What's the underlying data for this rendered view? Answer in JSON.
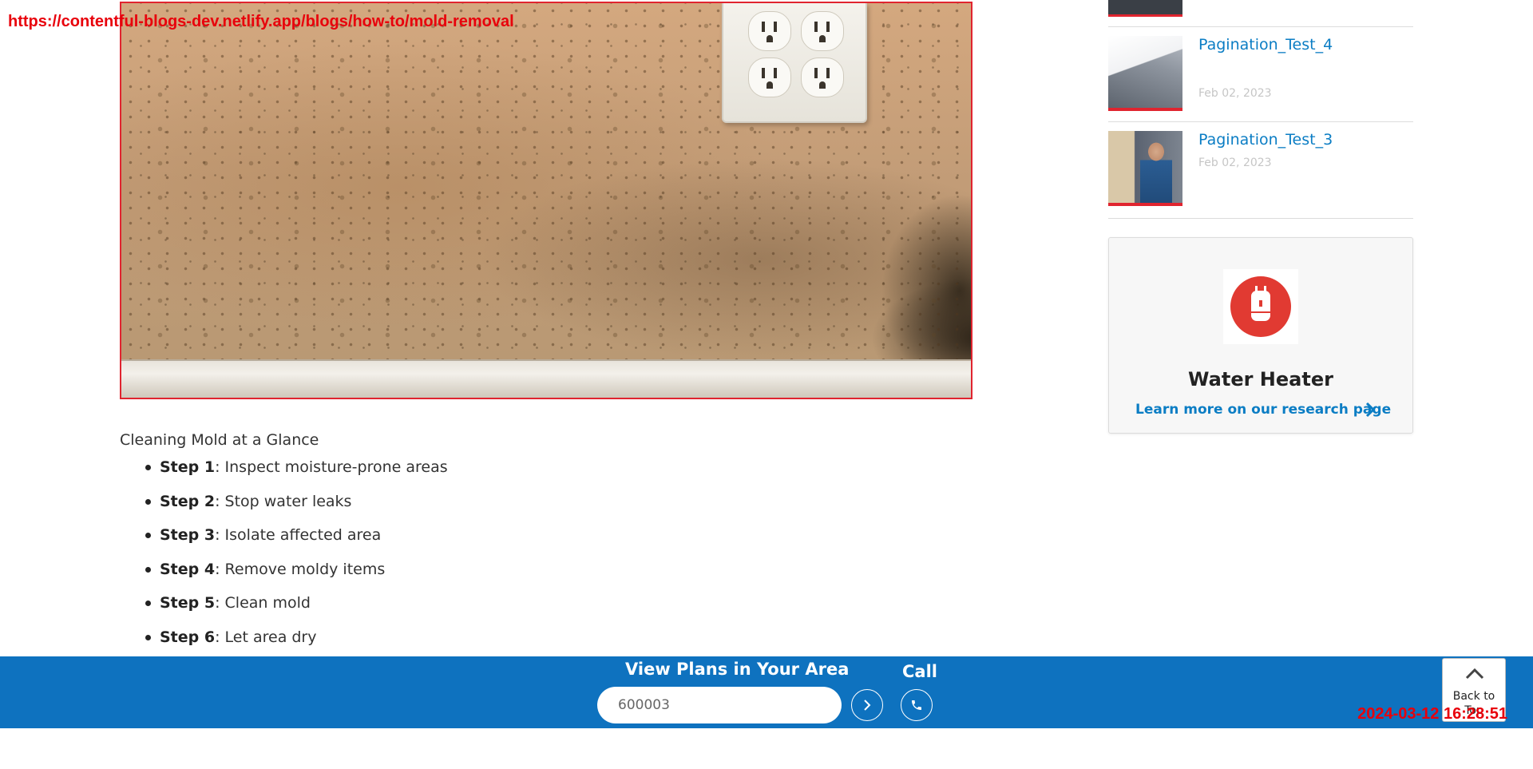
{
  "overlay": {
    "url": "https://contentful-blogs-dev.netlify.app/blogs/how-to/mold-removal",
    "timestamp": "2024-03-12 16:28:51"
  },
  "article": {
    "glance_heading": "Cleaning Mold at a Glance",
    "steps": [
      {
        "label": "Step 1",
        "text": ": Inspect moisture-prone areas"
      },
      {
        "label": "Step 2",
        "text": ": Stop water leaks"
      },
      {
        "label": "Step 3",
        "text": ": Isolate affected area"
      },
      {
        "label": "Step 4",
        "text": ": Remove moldy items"
      },
      {
        "label": "Step 5",
        "text": ": Clean mold"
      },
      {
        "label": "Step 6",
        "text": ": Let area dry"
      }
    ]
  },
  "sidebar": {
    "posts": [
      {
        "title": "Pagination_Test_4",
        "date": "Feb 02, 2023"
      },
      {
        "title": "Pagination_Test_3",
        "date": "Feb 02, 2023"
      }
    ],
    "promo": {
      "title": "Water Heater",
      "link_label": "Learn more on our research page",
      "icon_color": "#e13a32"
    }
  },
  "bottom_bar": {
    "zip_heading": "View Plans in Your Area",
    "zip_value": "600003",
    "call_label": "Call",
    "back_to_top_label": "Back to Top",
    "background_color": "#0e72bf"
  },
  "colors": {
    "link_blue": "#0b7dc4",
    "accent_red": "#e0242f"
  }
}
